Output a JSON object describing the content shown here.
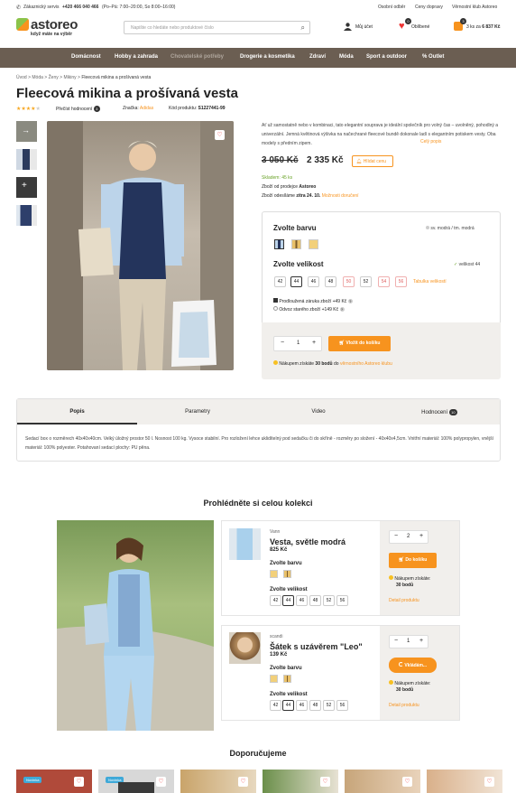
{
  "topbar": {
    "service": "Zákaznický servis",
    "phone": "+420 466 040 466",
    "hours": "(Po–Pá: 7:00–20:00, So 8:00–16:00)",
    "links": [
      "Osobní odběr",
      "Ceny dopravy",
      "Věrnostní klub Astoreo"
    ]
  },
  "header": {
    "brand": "astoreo",
    "tagline": "když máte na výběr",
    "search_placeholder": "Napište co hledáte nebo produktové číslo",
    "account": "Můj účet",
    "favorites": "Oblíbené",
    "fav_count": "0",
    "cart_count": "3",
    "cart_items": "3 ks za",
    "cart_total": "6 837 Kč"
  },
  "nav": [
    "Domácnost",
    "Hobby a zahrada",
    "Chovatelské potřeby",
    "Drogerie a kosmetika",
    "Zdraví",
    "Móda",
    "Sport a outdoor",
    "% Outlet"
  ],
  "breadcrumb": [
    "Úvod",
    ">",
    "Móda",
    ">",
    "Ženy",
    ">",
    "Mikiny",
    ">",
    "Fleecová mikina a prošívaná vesta"
  ],
  "product": {
    "title": "Fleecová mikina a prošívaná vesta",
    "reviews_label": "Přečíst hodnocení",
    "reviews_count": "3",
    "brand_label": "Značka:",
    "brand": "Adidas",
    "code_label": "Kód produktu:",
    "code": "S1227441-99",
    "rating": 4,
    "description": "Ať už samostatně nebo v kombinaci, tato elegantní souprava je ideální společník pro volný čas – uvolněný, pohodlný a univerzální. Jemná květinová výšivka na načechrané fleecové bundě dokonale ladí s elegantním potiskem vesty. Oba modely s předním zipem.",
    "desc_more": "Celý popis",
    "old_price": "3 050 Kč",
    "price": "2 335 Kč",
    "watch": "Hlídat cenu",
    "stock": "Skladem: 45 ks",
    "seller_label": "Zboží od prodejce",
    "seller": "Astoreo",
    "ship_label": "Zboží odesíláme",
    "ship_date": "zítra 24. 10.",
    "ship_options": "Možnosti doručení",
    "color_title": "Zvolte barvu",
    "color_selected": "sv. modrá / tm. modrá",
    "size_title": "Zvolte velikost",
    "size_selected": "velikost 44",
    "sizes": [
      "42",
      "44",
      "46",
      "48",
      "50",
      "52",
      "54",
      "56"
    ],
    "size_table": "Tabulka velikostí",
    "warranty": "Prodloužená záruka zboží +49 Kč",
    "disposal": "Odvoz starého zboží +149 Kč",
    "qty": "1",
    "cart_btn": "Vložit do košíku",
    "points_pre": "Nákupem získáte",
    "points": "30 bodů",
    "points_mid": "do",
    "points_club": "věrnostního Astoreo klubu"
  },
  "tabs": [
    {
      "label": "Popis"
    },
    {
      "label": "Parametry"
    },
    {
      "label": "Video"
    },
    {
      "label": "Hodnocení",
      "count": "10"
    }
  ],
  "tab_text": "Sedací box o rozměrech 40x40x40cm. Velký úložný prostor 50 l. Nosnost 100 kg. Vysoce stabilní. Pro rozložení lehce uklidítelný pod sedačku či do skříně - rozměry po složení - 40x40x4,5cm. Vnitřní materiál: 100% polypropylen, vnější materiál: 100% polyester. Potahovaní sedací plochy: PU pěna.",
  "collection": {
    "title": "Prohlédněte si celou kolekci",
    "items": [
      {
        "brand": "Vann",
        "name": "Vesta, světle modrá",
        "price": "825 Kč",
        "color_title": "Zvolte barvu",
        "size_title": "Zvolte velikost",
        "sizes": [
          "42",
          "44",
          "46",
          "48",
          "52",
          "56"
        ],
        "qty": "2",
        "btn": "Do košíku",
        "points_pre": "Nákupem získáte:",
        "points": "30 bodů",
        "detail": "Detail produktu"
      },
      {
        "brand": "scandi",
        "name": "Šátek s uzávěrem \"Leo\"",
        "price": "139 Kč",
        "color_title": "Zvolte barvu",
        "size_title": "Zvolte velikost",
        "sizes": [
          "42",
          "44",
          "46",
          "48",
          "52",
          "56"
        ],
        "qty": "1",
        "btn": "Vkládám...",
        "points_pre": "Nákupem získáte:",
        "points": "30 bodů",
        "detail": "Detail produktu"
      }
    ]
  },
  "recommend": {
    "title": "Doporučujeme",
    "badge": "Novinka"
  },
  "colors": {
    "accent": "#f7931e",
    "nav": "#6b5e52",
    "link": "#f7931e",
    "green": "#6aa329"
  }
}
